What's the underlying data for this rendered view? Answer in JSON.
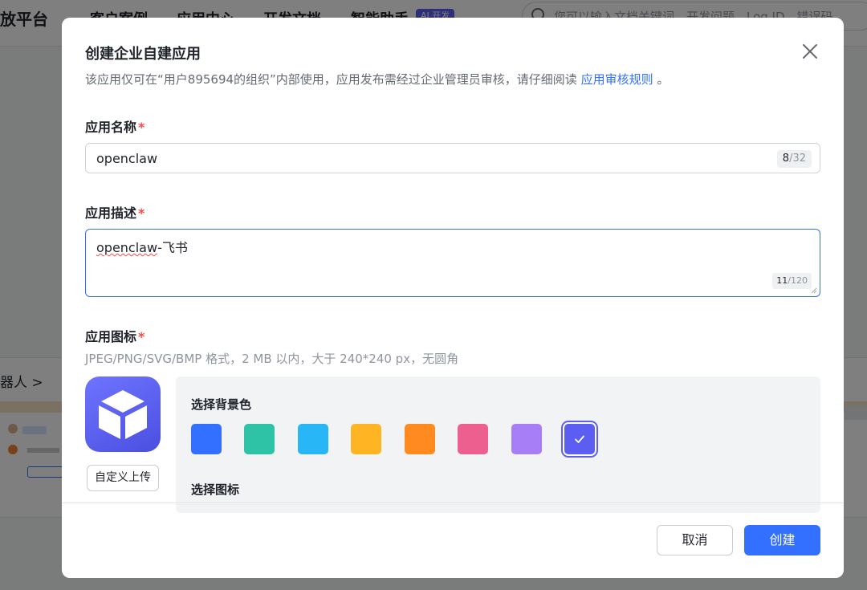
{
  "background": {
    "brand": "放平台",
    "nav": [
      "客户案例",
      "应用中心",
      "开发文档",
      "智能助手"
    ],
    "ai_badge": "AI 开发",
    "search_placeholder": "您可以输入文档关键词、开发问题、Log ID、错误码",
    "card_title": "器人 >"
  },
  "modal": {
    "title": "创建企业自建应用",
    "notice_text": "该应用仅可在“用户895694的组织”内部使用，应用发布需经过企业管理员审核，请仔细阅读 ",
    "notice_link": "应用审核规则",
    "notice_end": " 。",
    "name_field": {
      "label": "应用名称",
      "required_mark": "*",
      "value": "openclaw",
      "count_used": "8",
      "count_max": "/32"
    },
    "desc_field": {
      "label": "应用描述",
      "required_mark": "*",
      "value_spellcheck": "openclaw",
      "value_rest": "-飞书",
      "count_used": "11",
      "count_max": "/120"
    },
    "icon_field": {
      "label": "应用图标",
      "required_mark": "*",
      "hint": "JPEG/PNG/SVG/BMP 格式，2 MB 以内，大于 240*240 px，无圆角",
      "upload_label": "自定义上传",
      "bg_color_title": "选择背景色",
      "icon_title": "选择图标",
      "icon_name": "cube-icon",
      "colors": [
        "#3370ff",
        "#2ec2a6",
        "#29b6f6",
        "#ffb523",
        "#ff8a1f",
        "#ec5f8f",
        "#a77ef5",
        "#5b5ef0"
      ],
      "selected_color": "#5b5ef0"
    },
    "actions": {
      "cancel_label": "取消",
      "create_label": "创建"
    }
  }
}
